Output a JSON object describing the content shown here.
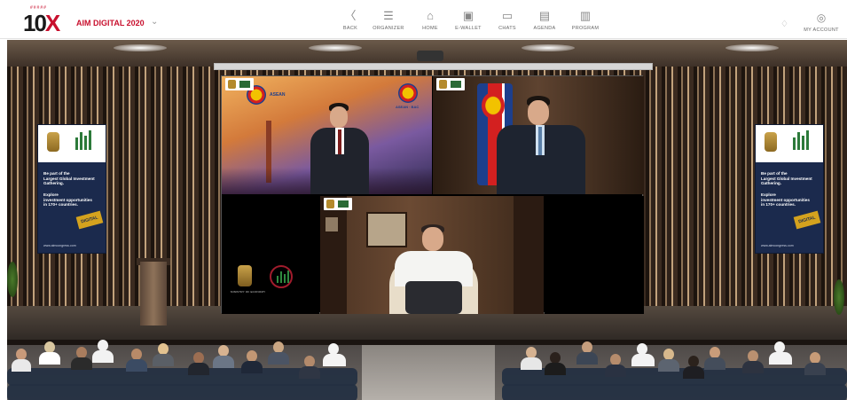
{
  "brand": {
    "logo_top": "#####",
    "logo_main": "10",
    "logo_x": "X"
  },
  "event": {
    "title": "AIM DIGITAL 2020",
    "chevron": "⌄"
  },
  "nav": [
    {
      "label": "BACK",
      "icon": "back-icon",
      "glyph": "〈"
    },
    {
      "label": "ORGANIZER",
      "icon": "organizer-icon",
      "glyph": "☰"
    },
    {
      "label": "HOME",
      "icon": "home-icon",
      "glyph": "⌂"
    },
    {
      "label": "E-WALLET",
      "icon": "wallet-icon",
      "glyph": "▣"
    },
    {
      "label": "CHATS",
      "icon": "chat-icon",
      "glyph": "▭"
    },
    {
      "label": "AGENDA",
      "icon": "agenda-icon",
      "glyph": "▤"
    },
    {
      "label": "PROGRAM",
      "icon": "program-icon",
      "glyph": "▥"
    }
  ],
  "account": {
    "label": "MY ACCOUNT",
    "glyph": "◎",
    "bell_glyph": "♢"
  },
  "banner": {
    "line1": "Be part of the",
    "line2": "Largest Global Investment",
    "line3": "Gathering.",
    "line4": "Explore",
    "line5": "investment opportunities",
    "line6": "in 170+ countries.",
    "stamp": "DIGITAL",
    "url": "www.aimcongress.com"
  },
  "screen": {
    "asean_left": "ASEAN",
    "asean_right": "ASEAN · BAC",
    "ministry_caption": "MINISTRY OF ECONOMY"
  },
  "colors": {
    "accent": "#c8102e",
    "banner_bg": "#1b2a4d",
    "asean_blue": "#1d3f8c"
  }
}
